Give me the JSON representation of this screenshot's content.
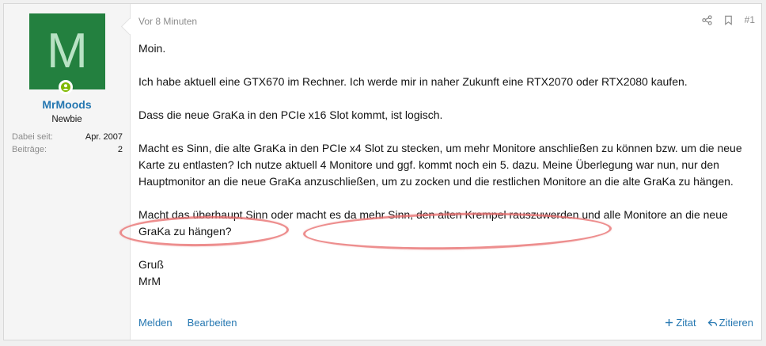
{
  "post": {
    "timestamp": "Vor 8 Minuten",
    "post_number": "#1",
    "body": [
      "Moin.",
      "Ich habe aktuell eine GTX670 im Rechner. Ich werde mir in naher Zukunft eine RTX2070 oder RTX2080 kaufen.",
      "Dass die neue GraKa in den PCIe x16 Slot kommt, ist logisch.",
      "Macht es Sinn, die alte GraKa in den PCIe x4 Slot zu stecken, um mehr Monitore anschließen zu können bzw. um die neue Karte zu entlasten? Ich nutze aktuell 4 Monitore und ggf. kommt noch ein 5. dazu. Meine Überlegung war nun, nur den Hauptmonitor an die neue GraKa anzuschließen, um zu zocken und die restlichen Monitore an die alte GraKa zu hängen.",
      "Macht das überhaupt Sinn oder macht es da mehr Sinn, den alten Krempel rauszuwerden und alle Monitore an die neue GraKa zu hängen?"
    ],
    "signoff": [
      "Gruß",
      "MrM"
    ]
  },
  "user": {
    "avatar_letter": "M",
    "avatar_color": "#23803f",
    "name": "MrMoods",
    "title": "Newbie",
    "stats": [
      {
        "label": "Dabei seit:",
        "value": "Apr. 2007"
      },
      {
        "label": "Beiträge:",
        "value": "2"
      }
    ]
  },
  "footer": {
    "report": "Melden",
    "edit": "Bearbeiten",
    "multiquote": "Zitat",
    "quote": "Zitieren"
  },
  "colors": {
    "link": "#2577b1",
    "muted": "#8c8c8c",
    "annotation": "#e86e6e"
  }
}
